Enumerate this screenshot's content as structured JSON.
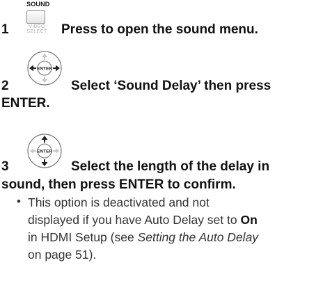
{
  "step1": {
    "number": "1",
    "button_top_label": "SOUND",
    "button_sub_line1": "VIDEO",
    "button_sub_line2": "SELECT",
    "text": "Press to open the sound menu."
  },
  "step2": {
    "number": "2",
    "dpad_center_label": "ENTER",
    "text_line1": "Select ‘Sound Delay’ then press",
    "text_line2": "ENTER."
  },
  "step3": {
    "number": "3",
    "dpad_center_label": "ENTER",
    "text_line1": "Select the length of the delay in",
    "text_line2": "sound, then press ENTER to confirm."
  },
  "note": {
    "line1": "This option is deactivated and not",
    "line2_pre": "displayed if you have Auto Delay set to ",
    "line2_bold": "On",
    "line3_pre": "in HDMI Setup (see ",
    "line3_italic": "Setting the Auto Delay",
    "line4": "on page 51)."
  },
  "icons": {
    "dpad_step2_active": "left-right",
    "dpad_step3_active": "up-down"
  }
}
